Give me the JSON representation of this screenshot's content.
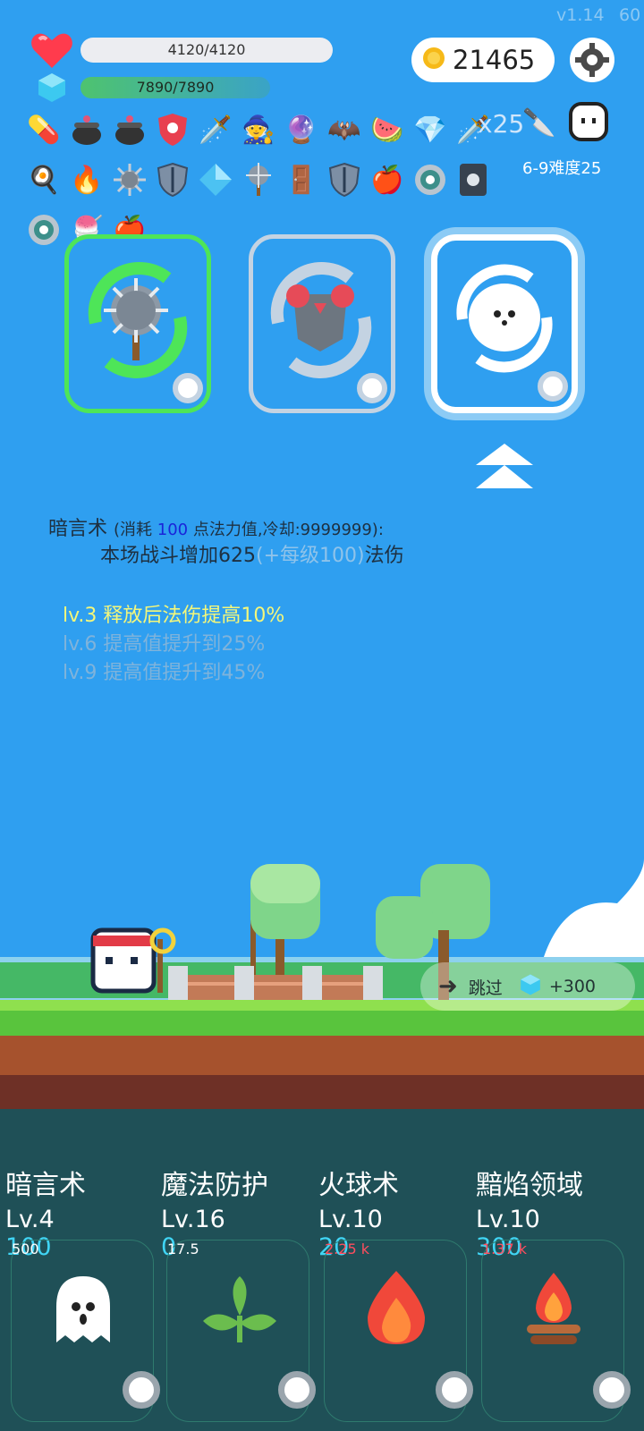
{
  "header": {
    "version": "v1.14",
    "fps": "60"
  },
  "stats": {
    "hp": "4120/4120",
    "mp": "7890/7890",
    "coins": "21465"
  },
  "inventory": {
    "row1_count": "x25",
    "difficulty": "6-9难度25"
  },
  "cards": [
    {
      "icon": "mace-icon",
      "border": "#4ee558"
    },
    {
      "icon": "armor-icon",
      "border": "#c4d3e2"
    },
    {
      "icon": "ghost-icon",
      "border": "#ffffff"
    }
  ],
  "description": {
    "skill_name": "暗言术",
    "cost_prefix": "(消耗 ",
    "cost_value": "100",
    "cost_suffix": " 点法力值,冷却:9999999):",
    "effect_prefix": "本场战斗增加625",
    "effect_per_level": "(+每级100)",
    "effect_suffix": "法伤",
    "levels": [
      "lv.3 释放后法伤提高10%",
      "lv.6 提高值提升到25%",
      "lv.9 提高值提升到45%"
    ]
  },
  "skip": {
    "label": "跳过",
    "reward": "+300"
  },
  "skills": [
    {
      "name": "暗言术",
      "level": "Lv.4",
      "cost": "100",
      "upgrade": "500",
      "upgrade_color": "#ffffff",
      "icon": "ghost-icon"
    },
    {
      "name": "魔法防护",
      "level": "Lv.16",
      "cost": "0",
      "upgrade": "17.5",
      "upgrade_color": "#ffffff",
      "icon": "leaf-icon"
    },
    {
      "name": "火球术",
      "level": "Lv.10",
      "cost": "20",
      "upgrade": "2.25 k",
      "upgrade_color": "#ff4d5e",
      "icon": "fire-icon"
    },
    {
      "name": "黯焰领域",
      "level": "Lv.10",
      "cost": "300",
      "upgrade": "1.37 k",
      "upgrade_color": "#ff4d5e",
      "icon": "campfire-icon"
    }
  ]
}
